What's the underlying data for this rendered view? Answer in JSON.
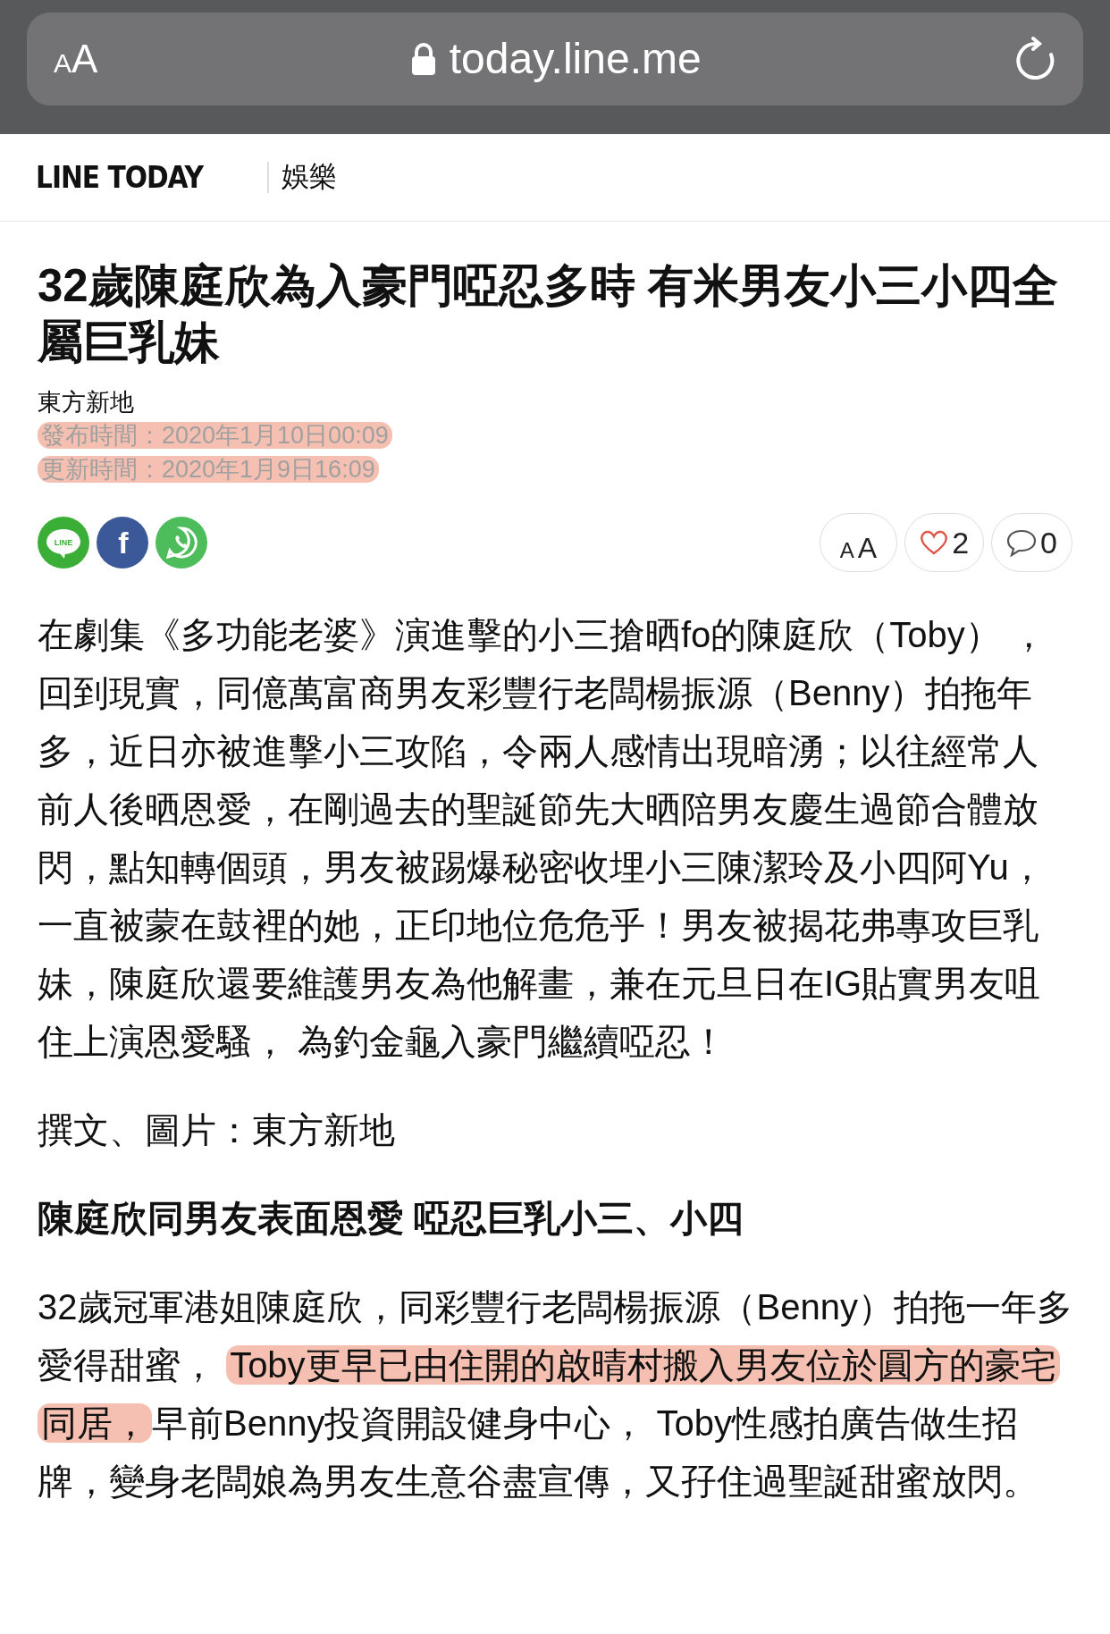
{
  "browser_bar": {
    "text_size_button": {
      "small": "A",
      "large": "A"
    },
    "url": "today.line.me"
  },
  "site_header": {
    "logo": "LINE TODAY",
    "category": "娛樂"
  },
  "article": {
    "title": "32歲陳庭欣為入豪門啞忍多時 有米男友小三小四全屬巨乳妹",
    "source": "東方新地",
    "dates": [
      {
        "text": "發布時間：2020年1月10日00:09",
        "highlighted": true
      },
      {
        "text": "更新時間：2020年1月9日16:09",
        "highlighted": true
      }
    ],
    "share_icons": [
      {
        "kind": "line",
        "label": "LINE"
      },
      {
        "kind": "facebook",
        "label": "f"
      },
      {
        "kind": "whatsapp"
      }
    ],
    "actions": {
      "text_size": {
        "small": "A",
        "large": "A"
      },
      "likes": "2",
      "comments": "0"
    },
    "body": [
      {
        "kind": "paragraph",
        "segments": [
          {
            "text": "在劇集《多功能老婆》演進擊的小三搶晒fo的陳庭欣（Toby） ，回到現實，同億萬富商男友彩豐行老闆楊振源（Benny）拍拖年多，近日亦被進擊小三攻陷，令兩人感情出現暗湧；以往經常人前人後晒恩愛，在剛過去的聖誕節先大晒陪男友慶生過節合體放閃，點知轉個頭，男友被踢爆秘密收埋小三陳潔玲及小四阿Yu，一直被蒙在鼓裡的她，正印地位危危乎！男友被揭花弗專攻巨乳妹，陳庭欣還要維護男友為他解畫，兼在元旦日在IG貼實男友咀住上演恩愛騷， 為釣金龜入豪門繼續啞忍！",
            "highlighted": false
          }
        ]
      },
      {
        "kind": "paragraph",
        "segments": [
          {
            "text": "撰文、圖片：東方新地",
            "highlighted": false
          }
        ]
      },
      {
        "kind": "heading",
        "text": "陳庭欣同男友表面恩愛 啞忍巨乳小三、小四"
      },
      {
        "kind": "paragraph",
        "segments": [
          {
            "text": "32歲冠軍港姐陳庭欣，同彩豐行老闆楊振源（Benny）拍拖一年多愛得甜蜜， ",
            "highlighted": false
          },
          {
            "text": "Toby更早已由住開的啟晴村搬入男友位於圓方的豪宅同居，",
            "highlighted": true
          },
          {
            "text": "早前Benny投資開設健身中心， Toby性感拍廣告做生招牌，變身老闆娘為男友生意谷盡宣傳，又孖住過聖誕甜蜜放閃。",
            "highlighted": false
          }
        ]
      }
    ]
  }
}
